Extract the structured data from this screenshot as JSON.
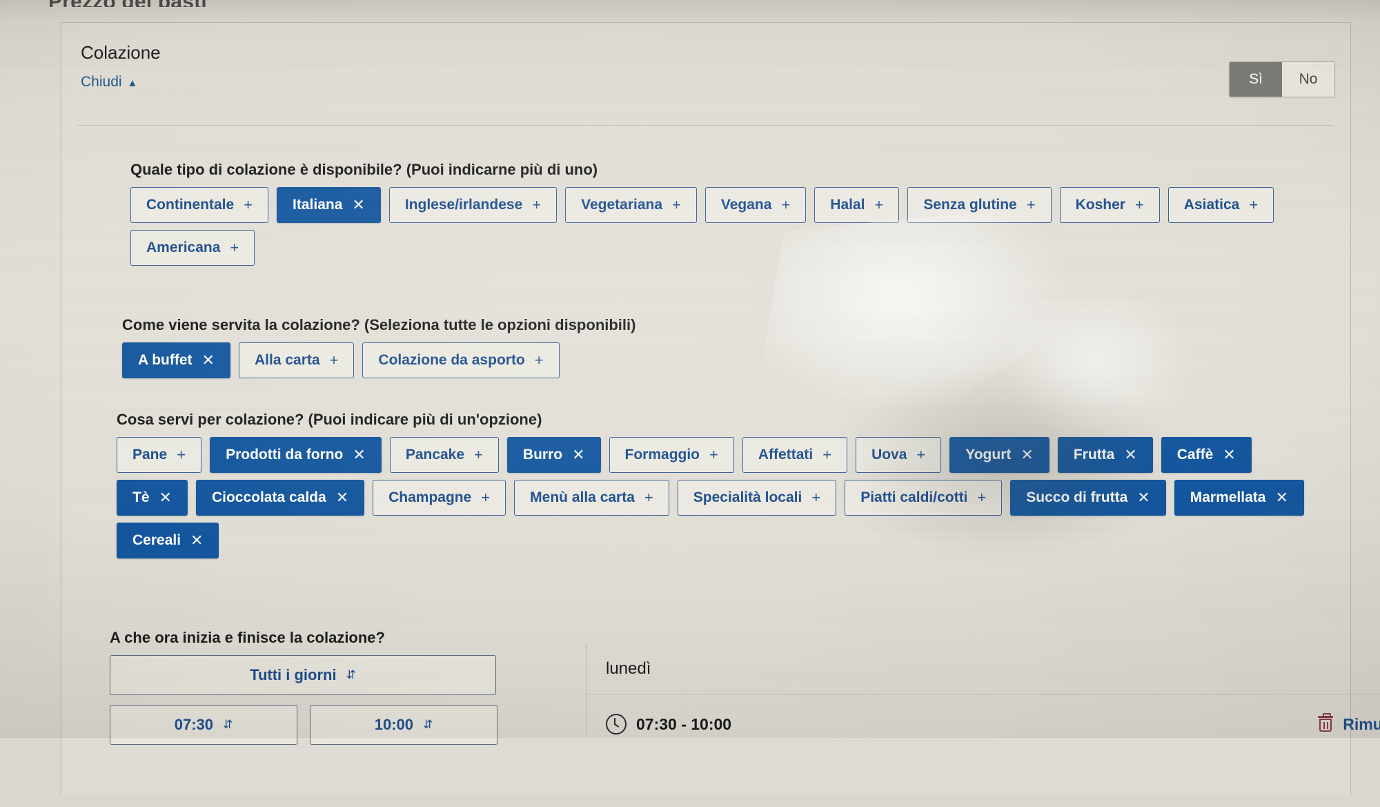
{
  "page": {
    "cut_off_heading": "Prezzo dei pasti"
  },
  "card": {
    "title": "Colazione",
    "close_label": "Chiudi",
    "close_icon": "chevron-up-icon",
    "toggle": {
      "yes": "Sì",
      "no": "No",
      "selected": "Sì"
    }
  },
  "questions": [
    {
      "label": "Quale tipo di colazione è disponibile? (Puoi indicarne più di uno)",
      "options": [
        {
          "label": "Continentale",
          "selected": false
        },
        {
          "label": "Italiana",
          "selected": true
        },
        {
          "label": "Inglese/irlandese",
          "selected": false
        },
        {
          "label": "Vegetariana",
          "selected": false
        },
        {
          "label": "Vegana",
          "selected": false
        },
        {
          "label": "Halal",
          "selected": false
        },
        {
          "label": "Senza glutine",
          "selected": false
        },
        {
          "label": "Kosher",
          "selected": false
        },
        {
          "label": "Asiatica",
          "selected": false
        },
        {
          "label": "Americana",
          "selected": false
        }
      ]
    },
    {
      "label": "Come viene servita la colazione? (Seleziona tutte le opzioni disponibili)",
      "options": [
        {
          "label": "A buffet",
          "selected": true
        },
        {
          "label": "Alla carta",
          "selected": false
        },
        {
          "label": "Colazione da asporto",
          "selected": false
        }
      ]
    },
    {
      "label": "Cosa servi per colazione? (Puoi indicare più di un'opzione)",
      "options": [
        {
          "label": "Pane",
          "selected": false
        },
        {
          "label": "Prodotti da forno",
          "selected": true
        },
        {
          "label": "Pancake",
          "selected": false
        },
        {
          "label": "Burro",
          "selected": true
        },
        {
          "label": "Formaggio",
          "selected": false
        },
        {
          "label": "Affettati",
          "selected": false
        },
        {
          "label": "Uova",
          "selected": false
        },
        {
          "label": "Yogurt",
          "selected": true
        },
        {
          "label": "Frutta",
          "selected": true
        },
        {
          "label": "Caffè",
          "selected": true
        },
        {
          "label": "Tè",
          "selected": true
        },
        {
          "label": "Cioccolata calda",
          "selected": true
        },
        {
          "label": "Champagne",
          "selected": false
        },
        {
          "label": "Menù alla carta",
          "selected": false
        },
        {
          "label": "Specialità locali",
          "selected": false
        },
        {
          "label": "Piatti caldi/cotti",
          "selected": false
        },
        {
          "label": "Succo di frutta",
          "selected": true
        },
        {
          "label": "Marmellata",
          "selected": true
        },
        {
          "label": "Cereali",
          "selected": true
        }
      ]
    }
  ],
  "schedule": {
    "label": "A che ora inizia e finisce la colazione?",
    "days_value": "Tutti i giorni",
    "start_value": "07:30",
    "end_value": "10:00",
    "day_name": "lunedì",
    "day_hours": "07:30 - 10:00",
    "remove_label": "Rimuovi",
    "remove_icon": "trash-icon",
    "clock_icon": "clock-icon"
  },
  "icons": {
    "add": "+",
    "remove": "✕",
    "caret": "⌃⌄"
  },
  "colors": {
    "accent_blue": "#14579f",
    "link_blue": "#1d4e8f",
    "toggle_on": "#7d7c76",
    "trash_red": "#8a3b44"
  }
}
